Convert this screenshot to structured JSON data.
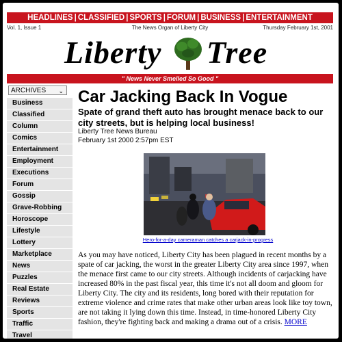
{
  "topnav": [
    "HEADLINES",
    "CLASSIFIED",
    "SPORTS",
    "FORUM",
    "BUSINESS",
    "ENTERTAINMENT"
  ],
  "infobar": {
    "volume": "Vol. 1, Issue 1",
    "tagline": "The News Organ of Liberty City",
    "date": "Thursday February 1st, 2001"
  },
  "logo": {
    "left_word": "Liberty",
    "right_word": "Tree",
    "tree_color": "#2e6b1f"
  },
  "slogan": "\" News Never Smelled So Good \"",
  "sidebar": {
    "archives_label": "ARCHIVES",
    "items": [
      "Business",
      "Classified",
      "Column",
      "Comics",
      "Entertainment",
      "Employment",
      "Executions",
      "Forum",
      "Gossip",
      "Grave-Robbing",
      "Horoscope",
      "Lifestyle",
      "Lottery",
      "Marketplace",
      "News",
      "Puzzles",
      "Real Estate",
      "Reviews",
      "Sports",
      "Traffic",
      "Travel"
    ]
  },
  "article": {
    "headline": "Car Jacking Back In Vogue",
    "dek": "Spate of grand theft auto has brought menace back to our city streets, but is helping local business!",
    "bureau": "Liberty Tree News Bureau",
    "timestamp": "February 1st 2000 2:57pm EST",
    "caption": "Hero-for-a-day cameraman catches a carjack-in-progress",
    "body": "As you may have noticed, Liberty City has been plagued in recent months by a spate of car jacking, the worst in the greater Liberty City area since 1997, when the menace first came to our city streets. Although incidents of carjacking have increased 80% in the past fiscal year, this time it's not all doom and gloom for Liberty City. The city and its residents, long bored with their reputation for extreme violence and crime rates that make other urban areas look like toy town, are not taking it lying down this time. Instead, in time-honored Liberty City fashion, they're fighting back and making a drama out of a crisis.",
    "more_link": "MORE"
  },
  "colors": {
    "accent_red": "#c8141e",
    "sidebar_gray": "#e4e4e4",
    "link_blue": "#0000cc"
  }
}
